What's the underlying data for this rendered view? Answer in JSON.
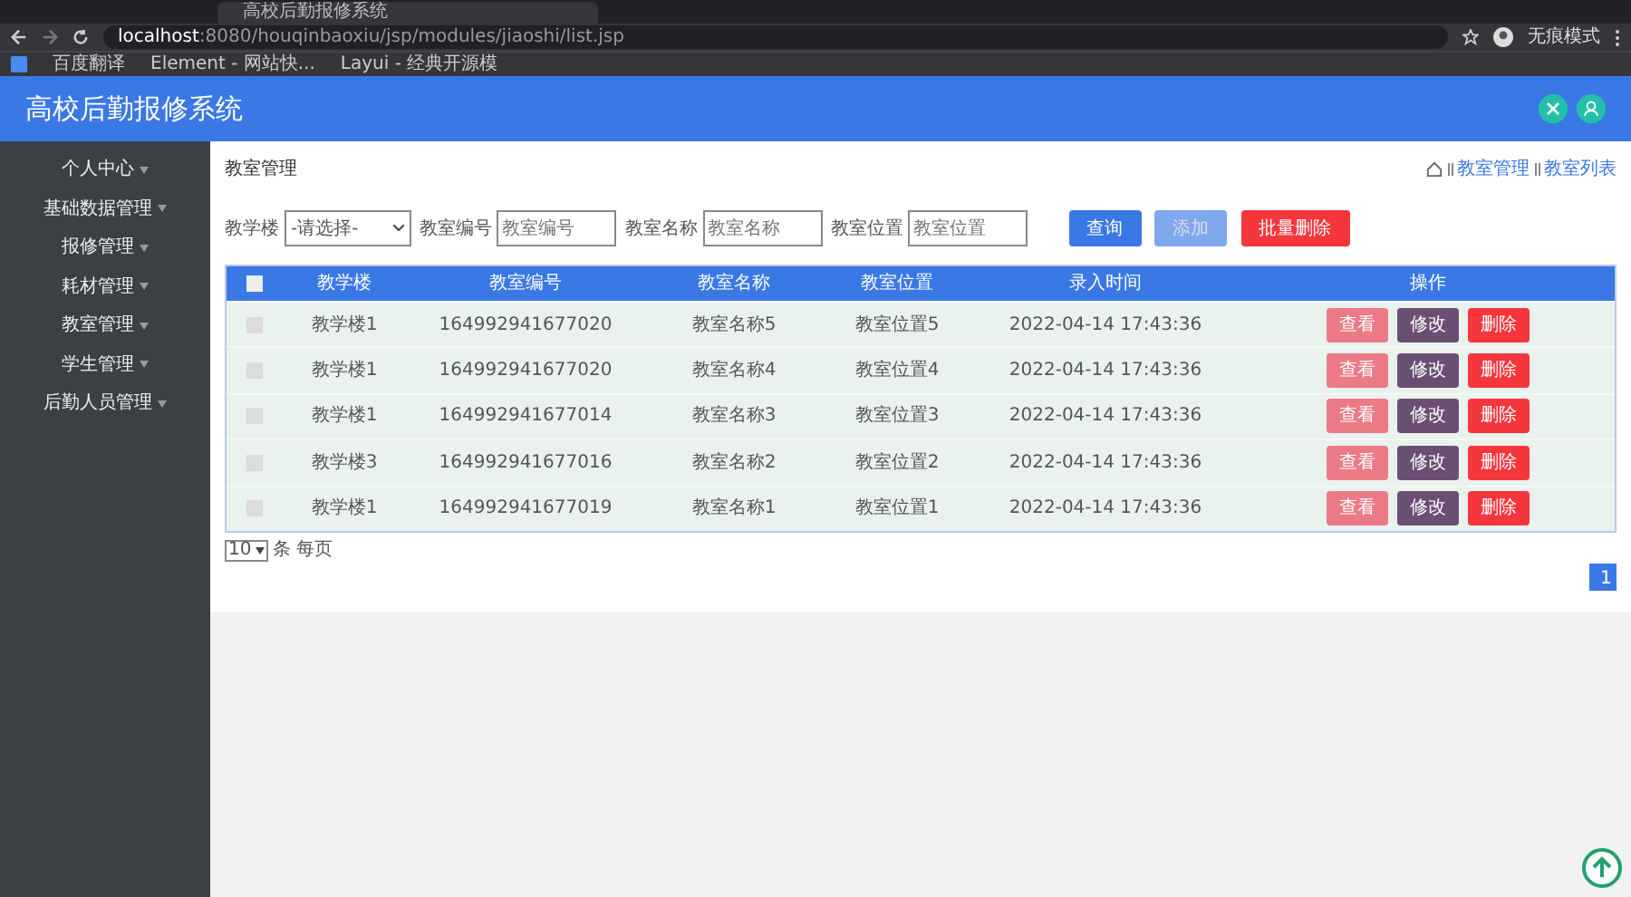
{
  "browser": {
    "tab_title": "高校后勤报修系统",
    "url_host": "localhost",
    "url_rest": ":8080/houqinbaoxiu/jsp/modules/jiaoshi/list.jsp",
    "profile": "无痕模式",
    "bookmarks": [
      "百度翻译",
      "Element - 网站快...",
      "Layui - 经典开源模"
    ]
  },
  "app": {
    "title": "高校后勤报修系统"
  },
  "sidebar": {
    "items": [
      {
        "label": "个人中心"
      },
      {
        "label": "基础数据管理"
      },
      {
        "label": "报修管理"
      },
      {
        "label": "耗材管理"
      },
      {
        "label": "教室管理"
      },
      {
        "label": "学生管理"
      },
      {
        "label": "后勤人员管理"
      }
    ]
  },
  "page": {
    "title": "教室管理",
    "breadcrumb": [
      "教室管理",
      "教室列表"
    ]
  },
  "filters": [
    {
      "kind": "select",
      "label": "教学楼",
      "value": "-请选择-"
    },
    {
      "kind": "input",
      "label": "教室编号",
      "placeholder": "教室编号"
    },
    {
      "kind": "input",
      "label": "教室名称",
      "placeholder": "教室名称"
    },
    {
      "kind": "input",
      "label": "教室位置",
      "placeholder": "教室位置"
    }
  ],
  "actions": [
    {
      "label": "查询",
      "kind": "primary"
    },
    {
      "label": "添加",
      "kind": "light"
    },
    {
      "label": "批量删除",
      "kind": "danger"
    }
  ],
  "table": {
    "columns": [
      "教学楼",
      "教室编号",
      "教室名称",
      "教室位置",
      "录入时间",
      "操作"
    ],
    "header_checked": false,
    "rows": [
      {
        "checked": false,
        "cells": [
          "教学楼1",
          "164992941677020",
          "教室名称5",
          "教室位置5",
          "2022-04-14 17:43:36"
        ],
        "actions": [
          {
            "label": "查看",
            "kind": "view"
          },
          {
            "label": "修改",
            "kind": "edit"
          },
          {
            "label": "删除",
            "kind": "delete"
          }
        ]
      },
      {
        "checked": false,
        "cells": [
          "教学楼1",
          "164992941677020",
          "教室名称4",
          "教室位置4",
          "2022-04-14 17:43:36"
        ],
        "actions": [
          {
            "label": "查看",
            "kind": "view"
          },
          {
            "label": "修改",
            "kind": "edit"
          },
          {
            "label": "删除",
            "kind": "delete"
          }
        ]
      },
      {
        "checked": false,
        "cells": [
          "教学楼1",
          "164992941677014",
          "教室名称3",
          "教室位置3",
          "2022-04-14 17:43:36"
        ],
        "actions": [
          {
            "label": "查看",
            "kind": "view"
          },
          {
            "label": "修改",
            "kind": "edit"
          },
          {
            "label": "删除",
            "kind": "delete"
          }
        ]
      },
      {
        "checked": false,
        "cells": [
          "教学楼3",
          "164992941677016",
          "教室名称2",
          "教室位置2",
          "2022-04-14 17:43:36"
        ],
        "actions": [
          {
            "label": "查看",
            "kind": "view"
          },
          {
            "label": "修改",
            "kind": "edit"
          },
          {
            "label": "删除",
            "kind": "delete"
          }
        ]
      },
      {
        "checked": false,
        "cells": [
          "教学楼1",
          "164992941677019",
          "教室名称1",
          "教室位置1",
          "2022-04-14 17:43:36"
        ],
        "actions": [
          {
            "label": "查看",
            "kind": "view"
          },
          {
            "label": "修改",
            "kind": "edit"
          },
          {
            "label": "删除",
            "kind": "delete"
          }
        ]
      }
    ]
  },
  "pager": {
    "page_size": "10",
    "page_size_label": "条 每页",
    "pages": [
      {
        "label": "1",
        "selected": true
      }
    ]
  }
}
